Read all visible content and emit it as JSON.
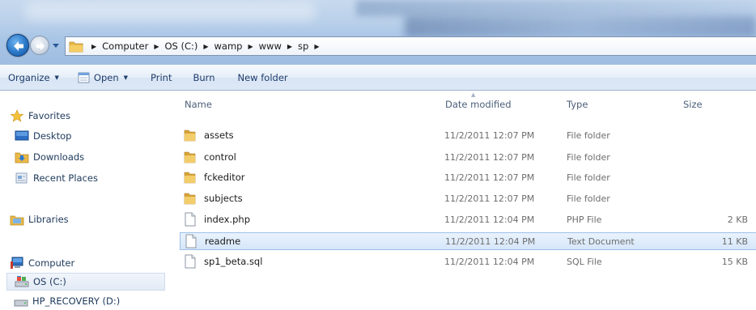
{
  "address_bar": {
    "crumbs": [
      "Computer",
      "OS (C:)",
      "wamp",
      "www",
      "sp"
    ]
  },
  "toolbar": {
    "organize_label": "Organize",
    "open_label": "Open",
    "print_label": "Print",
    "burn_label": "Burn",
    "new_folder_label": "New folder"
  },
  "nav_pane": {
    "favorites": "Favorites",
    "desktop": "Desktop",
    "downloads": "Downloads",
    "recent_places": "Recent Places",
    "libraries": "Libraries",
    "computer": "Computer",
    "os_c": "OS (C:)",
    "hp_recovery": "HP_RECOVERY (D:)"
  },
  "columns": {
    "name": "Name",
    "date_modified": "Date modified",
    "type": "Type",
    "size": "Size"
  },
  "files": [
    {
      "name": "assets",
      "date": "11/2/2011 12:07 PM",
      "type": "File folder",
      "size": "",
      "icon": "folder-icon"
    },
    {
      "name": "control",
      "date": "11/2/2011 12:07 PM",
      "type": "File folder",
      "size": "",
      "icon": "folder-icon"
    },
    {
      "name": "fckeditor",
      "date": "11/2/2011 12:07 PM",
      "type": "File folder",
      "size": "",
      "icon": "folder-icon"
    },
    {
      "name": "subjects",
      "date": "11/2/2011 12:07 PM",
      "type": "File folder",
      "size": "",
      "icon": "folder-icon"
    },
    {
      "name": "index.php",
      "date": "11/2/2011 12:04 PM",
      "type": "PHP File",
      "size": "2 KB",
      "icon": "file-icon"
    },
    {
      "name": "readme",
      "date": "11/2/2011 12:04 PM",
      "type": "Text Document",
      "size": "11 KB",
      "icon": "file-icon",
      "selected": true
    },
    {
      "name": "sp1_beta.sql",
      "date": "11/2/2011 12:04 PM",
      "type": "SQL File",
      "size": "15 KB",
      "icon": "file-icon"
    }
  ],
  "colors": {
    "accent": "#2a78c8",
    "selection_fill": "#d6e6f9",
    "selection_border": "#9dc0e8",
    "folder": "#e8b84a"
  }
}
